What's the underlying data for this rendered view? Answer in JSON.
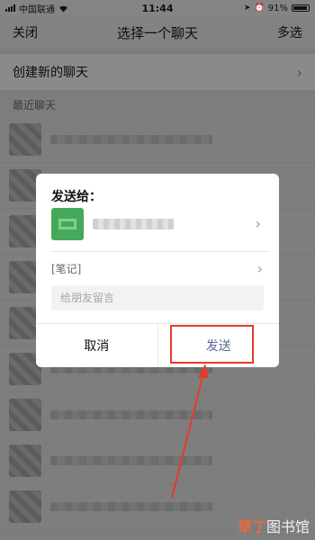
{
  "status_bar": {
    "carrier": "中国联通",
    "time": "11:44",
    "battery": "91%"
  },
  "nav": {
    "close_label": "关闭",
    "title": "选择一个聊天",
    "multi_select_label": "多选"
  },
  "create_chat": {
    "label": "创建新的聊天",
    "chevron": "›"
  },
  "recent_section": {
    "label": "最近聊天"
  },
  "chat_list": {
    "row_count": 9
  },
  "dialog": {
    "title": "发送给：",
    "note_label": "[笔记]",
    "chevron": "›",
    "message_placeholder": "给朋友留言",
    "cancel_label": "取消",
    "send_label": "发送"
  },
  "annotation": {
    "highlight_color": "#e53b2e"
  },
  "watermark": {
    "accent": "草丁",
    "text": "图书馆"
  }
}
